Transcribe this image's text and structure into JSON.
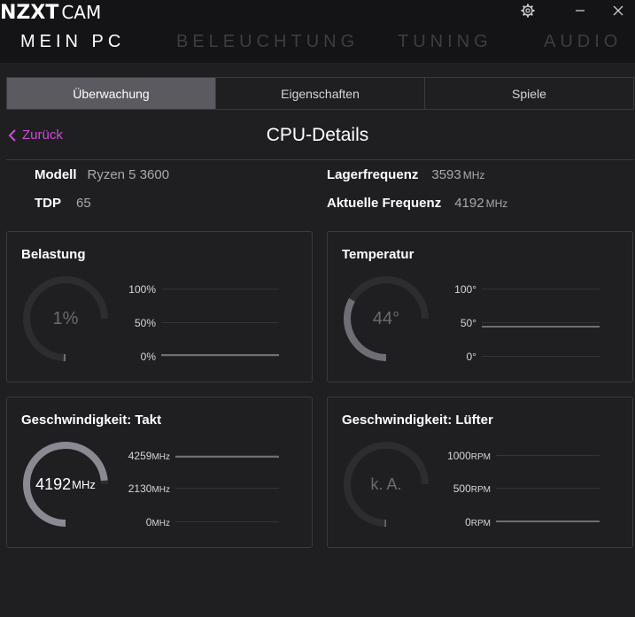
{
  "app": {
    "brand": "NZXT",
    "product": "CAM"
  },
  "window": {
    "settings_icon": "gear-icon",
    "minimize_label": "—",
    "close_label": "✕"
  },
  "nav": [
    {
      "label": "MEIN PC",
      "active": true
    },
    {
      "label": "BELEUCHTUNG",
      "active": false
    },
    {
      "label": "TUNING",
      "active": false
    },
    {
      "label": "AUDIO",
      "active": false
    }
  ],
  "tabs": [
    {
      "label": "Überwachung",
      "active": true
    },
    {
      "label": "Eigenschaften",
      "active": false
    },
    {
      "label": "Spiele",
      "active": false
    }
  ],
  "back_label": "Zurück",
  "page_title": "CPU-Details",
  "specs": {
    "model_label": "Modell",
    "model_value": "Ryzen 5 3600",
    "tdp_label": "TDP",
    "tdp_value": "65",
    "base_label": "Lagerfrequenz",
    "base_value": "3593",
    "base_unit": "MHz",
    "current_label": "Aktuelle Frequenz",
    "current_value": "4192",
    "current_unit": "MHz"
  },
  "cards": {
    "load": {
      "title": "Belastung",
      "value": "1%",
      "fraction": 0.01,
      "axis": [
        "100%",
        "50%",
        "0%"
      ],
      "line_level": 0.01
    },
    "temp": {
      "title": "Temperatur",
      "value": "44°",
      "fraction": 0.44,
      "axis": [
        "100°",
        "50°",
        "0°"
      ],
      "line_level": 0.44
    },
    "clock": {
      "title": "Geschwindigkeit: Takt",
      "value": "4192",
      "unit": "MHz",
      "fraction": 0.98,
      "axis": [
        {
          "v": "4259",
          "u": "MHz"
        },
        {
          "v": "2130",
          "u": "MHz"
        },
        {
          "v": "0",
          "u": "MHz"
        }
      ],
      "line_level": 0.98
    },
    "fan": {
      "title": "Geschwindigkeit: Lüfter",
      "value": "k. A.",
      "fraction": 0,
      "axis": [
        {
          "v": "1000",
          "u": "RPM"
        },
        {
          "v": "500",
          "u": "RPM"
        },
        {
          "v": "0",
          "u": "RPM"
        }
      ],
      "line_level": 0
    }
  },
  "colors": {
    "accent": "#c94fd6",
    "gauge_track": "#2d2d31",
    "gauge_fill": "#6e6e75",
    "gauge_fill_bright": "#8a8a92"
  }
}
